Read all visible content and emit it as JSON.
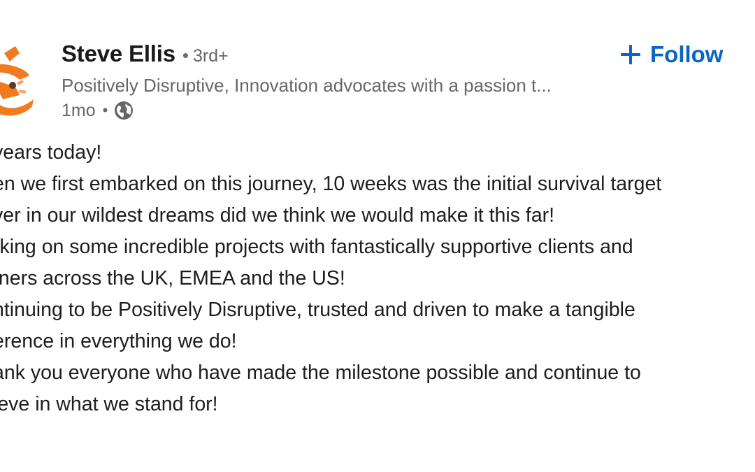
{
  "author": {
    "name": "Steve Ellis",
    "degree": "3rd+",
    "headline": "Positively Disruptive, Innovation advocates with a passion t...",
    "timestamp": "1mo",
    "visibility_icon": "globe-icon",
    "avatar_icon": "company-logo"
  },
  "follow": {
    "label": "Follow",
    "icon": "plus-icon",
    "color": "#0a66c2"
  },
  "post": {
    "lines": [
      "years today!",
      "en we first embarked on this journey, 10 weeks was the initial survival target",
      "ver in our wildest dreams did we think we would make it this far!",
      "rking on some incredible projects with fantastically supportive clients and",
      "tners across the UK, EMEA and the US!",
      "ntinuing to be Positively Disruptive, trusted and driven to make a tangible",
      "erence in everything we do!",
      "ank you everyone who have made the milestone possible and continue to",
      "ieve in what we stand for!"
    ]
  },
  "colors": {
    "logo_orange": "#f47a20",
    "muted_text": "#666666",
    "link_blue": "#0a66c2"
  }
}
